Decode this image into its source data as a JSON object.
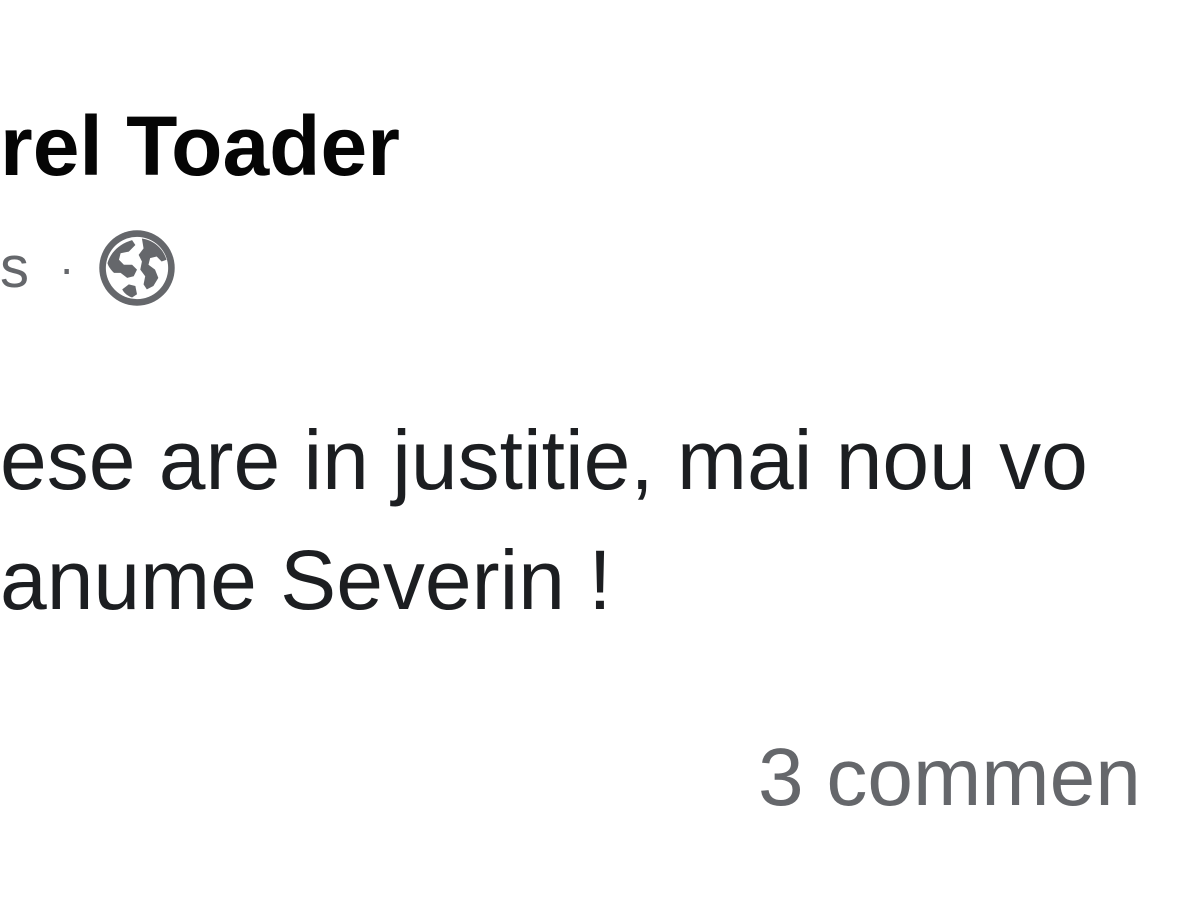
{
  "post": {
    "author": "rel Toader",
    "timestamp": "s",
    "separator": "·",
    "privacy_icon": "globe-icon",
    "text_lines": [
      "ese are in justitie, mai nou vo",
      "anume Severin !"
    ]
  },
  "footer": {
    "comments": "3 commen"
  },
  "colors": {
    "primary_text": "#050505",
    "body_text": "#1c1e21",
    "secondary_text": "#65676b",
    "background": "#ffffff"
  }
}
